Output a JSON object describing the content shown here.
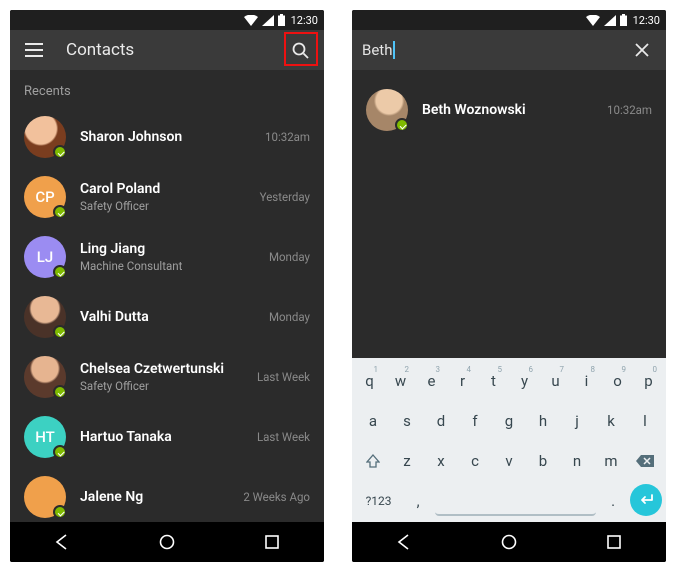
{
  "status": {
    "time": "12:30"
  },
  "left": {
    "title": "Contacts",
    "section": "Recents",
    "contacts": [
      {
        "name": "Sharon Johnson",
        "sub": "",
        "time": "10:32am",
        "avatar_type": "photo",
        "avatar_class": "photo1",
        "initials": ""
      },
      {
        "name": "Carol Poland",
        "sub": "Safety Officer",
        "time": "Yesterday",
        "avatar_type": "initials",
        "avatar_class": "",
        "initials": "CP",
        "avatar_bg": "#f0a04b"
      },
      {
        "name": "Ling Jiang",
        "sub": "Machine Consultant",
        "time": "Monday",
        "avatar_type": "initials",
        "avatar_class": "",
        "initials": "LJ",
        "avatar_bg": "#9b8cf2"
      },
      {
        "name": "Valhi Dutta",
        "sub": "",
        "time": "Monday",
        "avatar_type": "photo",
        "avatar_class": "photo2",
        "initials": ""
      },
      {
        "name": "Chelsea Czetwertunski",
        "sub": "Safety Officer",
        "time": "Last Week",
        "avatar_type": "photo",
        "avatar_class": "photo3",
        "initials": ""
      },
      {
        "name": "Hartuo Tanaka",
        "sub": "",
        "time": "Last Week",
        "avatar_type": "initials",
        "avatar_class": "",
        "initials": "HT",
        "avatar_bg": "#3cd1c2"
      },
      {
        "name": "Jalene Ng",
        "sub": "",
        "time": "2 Weeks Ago",
        "avatar_type": "initials",
        "avatar_class": "",
        "initials": "",
        "avatar_bg": "#f0a04b"
      }
    ]
  },
  "right": {
    "query": "Beth",
    "result": {
      "name": "Beth Woznowski",
      "time": "10:32am"
    }
  },
  "keyboard": {
    "row1": [
      {
        "k": "q",
        "s": "1"
      },
      {
        "k": "w",
        "s": "2"
      },
      {
        "k": "e",
        "s": "3"
      },
      {
        "k": "r",
        "s": "4"
      },
      {
        "k": "t",
        "s": "5"
      },
      {
        "k": "y",
        "s": "6"
      },
      {
        "k": "u",
        "s": "7"
      },
      {
        "k": "i",
        "s": "8"
      },
      {
        "k": "o",
        "s": "9"
      },
      {
        "k": "p",
        "s": "0"
      }
    ],
    "row2": [
      "a",
      "s",
      "d",
      "f",
      "g",
      "h",
      "j",
      "k",
      "l"
    ],
    "row3": [
      "z",
      "x",
      "c",
      "v",
      "b",
      "n",
      "m"
    ],
    "sym": "?123",
    "comma": ",",
    "period": "."
  }
}
